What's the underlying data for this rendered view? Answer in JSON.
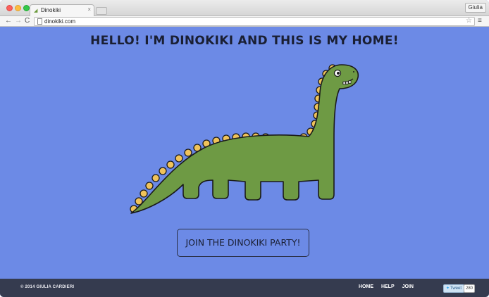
{
  "browser": {
    "tab_title": "Dinokiki",
    "tab_close": "×",
    "profile_name": "Giulia",
    "url": "dinokiki.com",
    "back_icon": "←",
    "forward_icon": "→",
    "reload_icon": "C",
    "star_icon": "☆",
    "menu_icon": "≡"
  },
  "page": {
    "headline": "HELLO! I'M DINOKIKI AND THIS IS MY HOME!",
    "cta_label": "JOIN THE DINOKIKI PARTY!",
    "colors": {
      "background": "#6c8ae6",
      "dino_body": "#6e9a44",
      "dino_spikes": "#f0c35a",
      "footer": "#353b4f"
    }
  },
  "footer": {
    "copyright": "© 2014 GIULIA CARDIERI",
    "links": [
      "HOME",
      "HELP",
      "JOIN"
    ],
    "tweet_label": "Tweet",
    "tweet_count": "280"
  }
}
